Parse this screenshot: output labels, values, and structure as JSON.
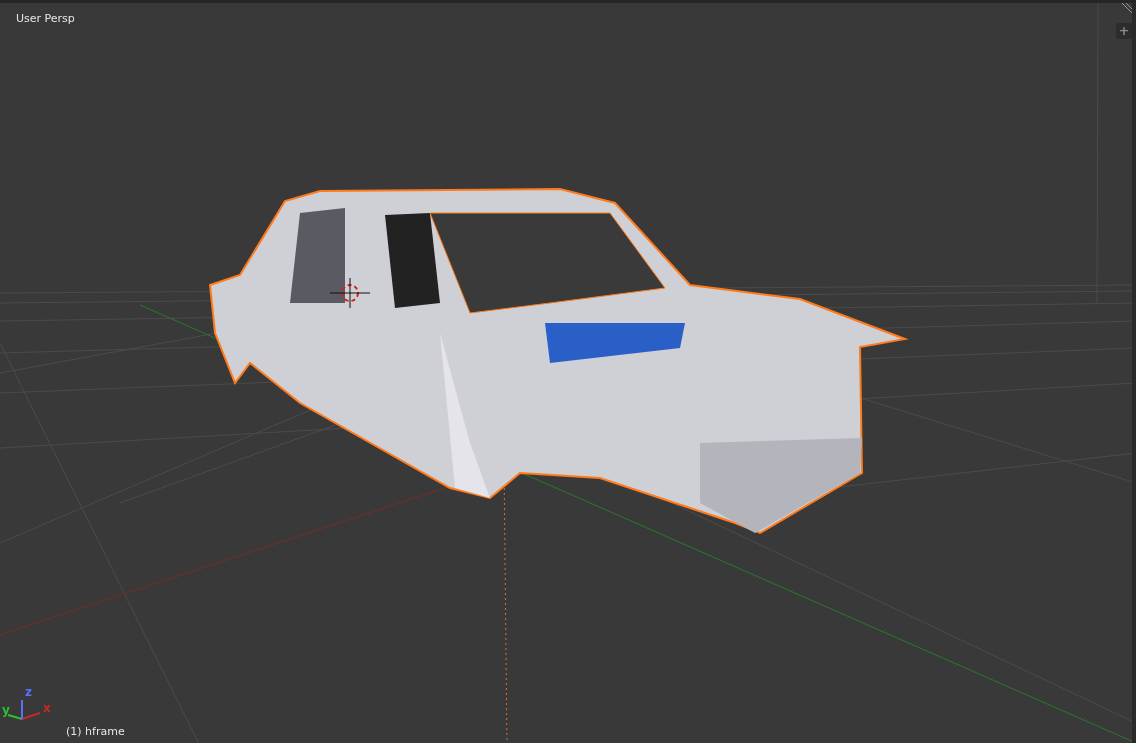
{
  "viewport": {
    "view_label": "User Persp",
    "object_label": "(1) hframe"
  },
  "axes": [
    {
      "label": "x",
      "color": "#c8282a"
    },
    {
      "label": "y",
      "color": "#2fbf2f"
    },
    {
      "label": "z",
      "color": "#5a70ff"
    }
  ],
  "add_button": {
    "label": "+"
  }
}
